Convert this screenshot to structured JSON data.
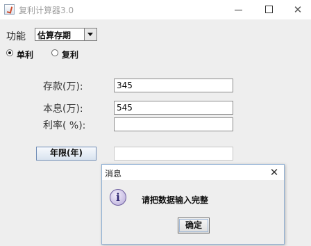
{
  "window": {
    "title": "复利计算器3.0",
    "close_glyph": "✕"
  },
  "form": {
    "function_label": "功能",
    "function_selected": "估算存期",
    "radio_simple": "单利",
    "radio_compound": "复利",
    "selected_radio": "单利",
    "deposit_label": "存款(万):",
    "deposit_value": "345",
    "principal_label": "本息(万):",
    "principal_value": "545",
    "rate_label": "利率( %):",
    "rate_value": "",
    "years_button": "年限(年)",
    "result_value": ""
  },
  "dialog": {
    "title": "消息",
    "icon": "info-icon",
    "icon_glyph": "i",
    "message": "请把数据输入完整",
    "ok_button": "确定",
    "close_glyph": "✕"
  },
  "colors": {
    "background": "#eeeeee",
    "dialog_border": "#8fb0d4",
    "button_border": "#6e8bb5"
  }
}
